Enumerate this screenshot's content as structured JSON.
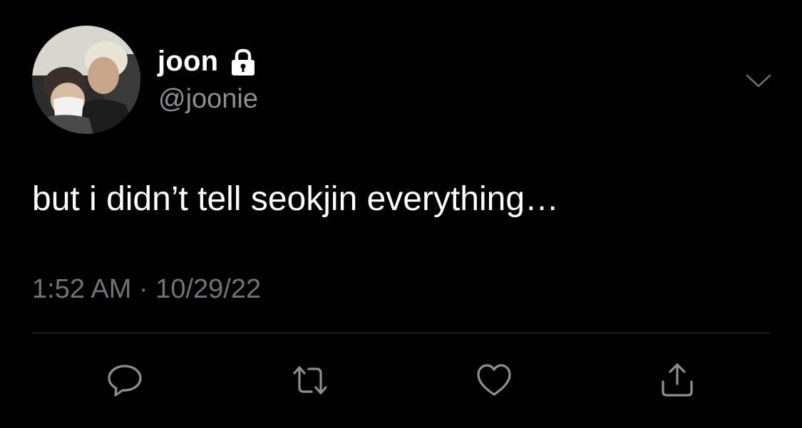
{
  "author": {
    "display_name": "joon",
    "handle": "@joonie",
    "avatar_icon": "profile-photo",
    "protected_icon": "lock-icon"
  },
  "tweet": {
    "text": "but i didn’t tell seokjin everything…",
    "timestamp": "1:52 AM · 10/29/22"
  },
  "actions": [
    {
      "name": "reply",
      "icon": "comment-icon"
    },
    {
      "name": "retweet",
      "icon": "retweet-icon"
    },
    {
      "name": "like",
      "icon": "heart-icon"
    },
    {
      "name": "share",
      "icon": "share-icon"
    }
  ],
  "colors": {
    "background": "#000000",
    "text_primary": "#ffffff",
    "text_secondary": "#8b8f94",
    "icon": "#8b8f94",
    "divider": "#2f3336"
  }
}
